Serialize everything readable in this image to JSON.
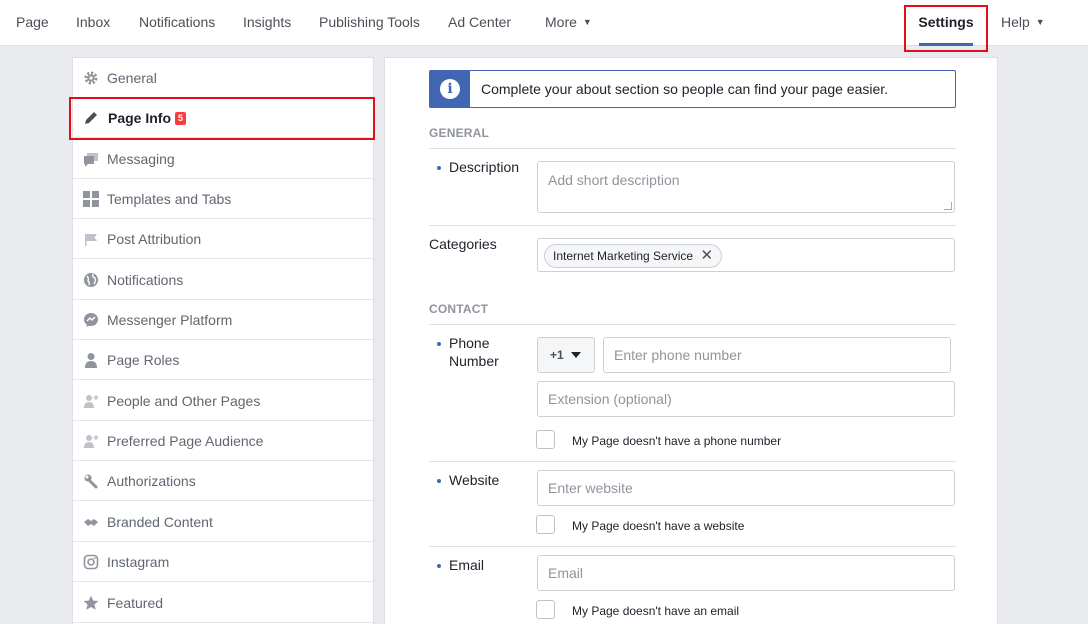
{
  "topnav": {
    "items": [
      {
        "label": "Page"
      },
      {
        "label": "Inbox"
      },
      {
        "label": "Notifications"
      },
      {
        "label": "Insights"
      },
      {
        "label": "Publishing Tools"
      },
      {
        "label": "Ad Center"
      },
      {
        "label": "More"
      }
    ],
    "settings_label": "Settings",
    "help_label": "Help"
  },
  "sidebar": {
    "items": [
      {
        "label": "General",
        "icon": "gear-icon"
      },
      {
        "label": "Page Info",
        "icon": "pencil-icon",
        "badge": "5",
        "active": true
      },
      {
        "label": "Messaging",
        "icon": "messaging-icon"
      },
      {
        "label": "Templates and Tabs",
        "icon": "grid-icon"
      },
      {
        "label": "Post Attribution",
        "icon": "flag-icon"
      },
      {
        "label": "Notifications",
        "icon": "globe-icon"
      },
      {
        "label": "Messenger Platform",
        "icon": "messenger-icon"
      },
      {
        "label": "Page Roles",
        "icon": "person-icon"
      },
      {
        "label": "People and Other Pages",
        "icon": "add-person-icon"
      },
      {
        "label": "Preferred Page Audience",
        "icon": "audience-icon"
      },
      {
        "label": "Authorizations",
        "icon": "wrench-icon"
      },
      {
        "label": "Branded Content",
        "icon": "handshake-icon"
      },
      {
        "label": "Instagram",
        "icon": "instagram-icon"
      },
      {
        "label": "Featured",
        "icon": "star-icon"
      }
    ]
  },
  "main": {
    "banner_text": "Complete your about section so people can find your page easier.",
    "general_heading": "GENERAL",
    "description_label": "Description",
    "description_placeholder": "Add short description",
    "categories_label": "Categories",
    "category_chip": "Internet Marketing Service",
    "contact_heading": "CONTACT",
    "phone_label_line1": "Phone",
    "phone_label_line2": "Number",
    "country_code": "+1",
    "phone_placeholder": "Enter phone number",
    "extension_placeholder": "Extension (optional)",
    "no_phone_label": "My Page doesn't have a phone number",
    "website_label": "Website",
    "website_placeholder": "Enter website",
    "no_website_label": "My Page doesn't have a website",
    "email_label": "Email",
    "email_placeholder": "Email",
    "no_email_label": "My Page doesn't have an email"
  },
  "colors": {
    "accent": "#4267b2",
    "highlight_box": "#e0101a",
    "badge": "#fa3e3e"
  }
}
